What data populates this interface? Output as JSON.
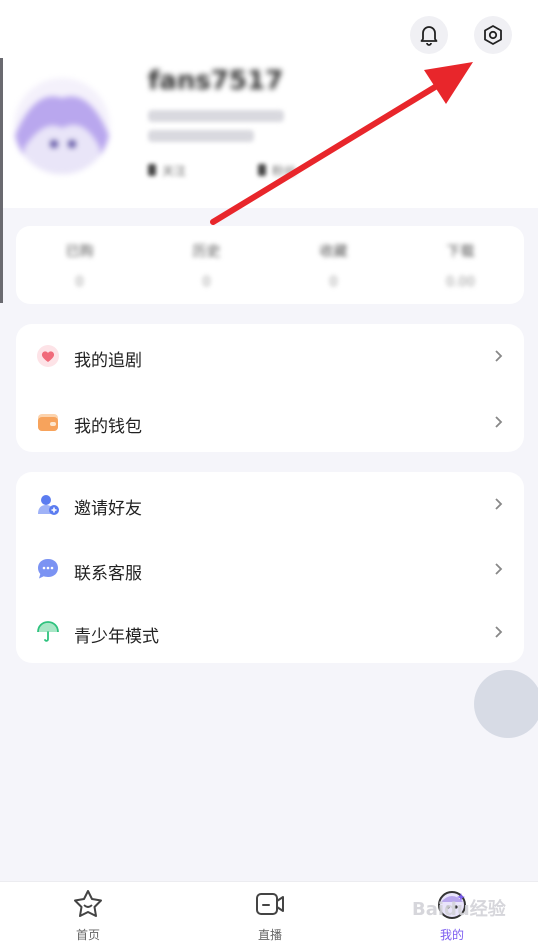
{
  "header": {
    "bell_icon": "bell-icon",
    "settings_icon": "settings-icon"
  },
  "profile": {
    "username": "fans7517",
    "follow_label": "关注",
    "fans_label": "粉丝"
  },
  "stats": [
    {
      "label": "已购",
      "value": "0"
    },
    {
      "label": "历史",
      "value": "0"
    },
    {
      "label": "收藏",
      "value": "0"
    },
    {
      "label": "下载",
      "value": "0.00"
    }
  ],
  "menu_group_1": [
    {
      "label": "我的追剧",
      "icon": "heart-icon",
      "color": "#f06a7a"
    },
    {
      "label": "我的钱包",
      "icon": "wallet-icon",
      "color": "#f7a35c"
    }
  ],
  "menu_group_2": [
    {
      "label": "邀请好友",
      "icon": "invite-user-icon",
      "color": "#5b7cf0"
    },
    {
      "label": "联系客服",
      "icon": "chat-bubble-icon",
      "color": "#6c87f2"
    },
    {
      "label": "青少年模式",
      "icon": "umbrella-icon",
      "color": "#2ec27e"
    }
  ],
  "tabbar": {
    "home_label": "首页",
    "live_label": "直播",
    "mine_label": "我的",
    "active_color": "#7b5cf0"
  },
  "watermark": "Baidu经验"
}
